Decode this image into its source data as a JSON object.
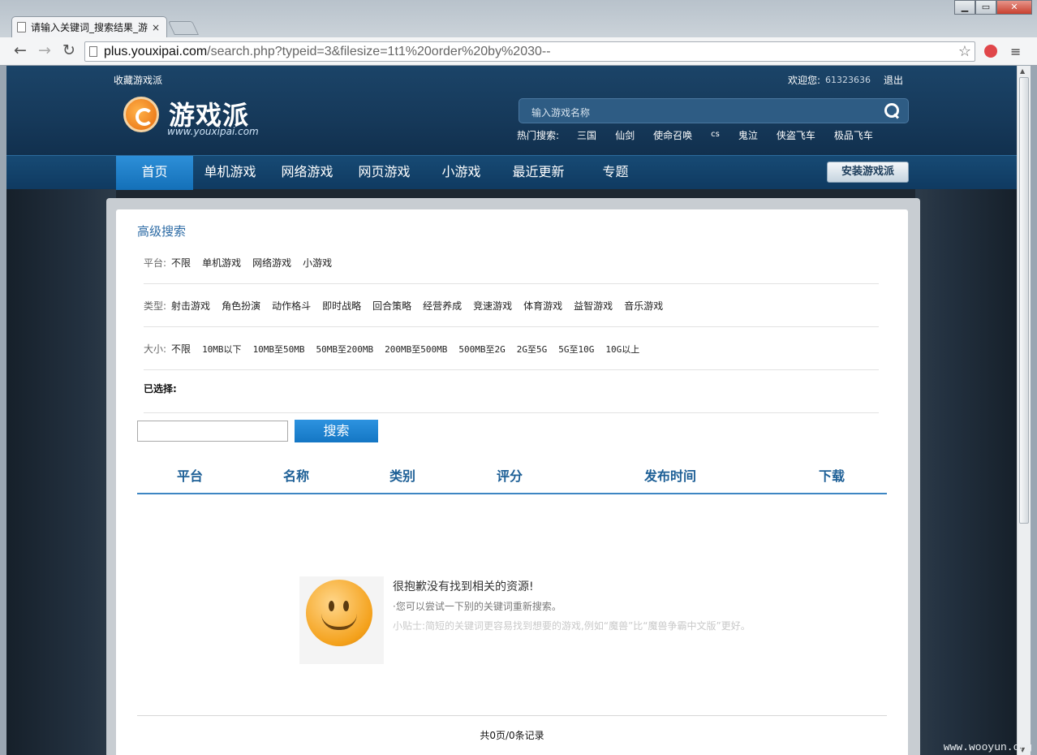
{
  "browser": {
    "tab_title": "请输入关键词_搜索结果_游",
    "tab_close": "×",
    "url_host": "plus.youxipai.com",
    "url_path": "/search.php?typeid=3&filesize=1t1%20order%20by%2030--",
    "win_min": "▁",
    "win_max": "▭",
    "win_close": "✕",
    "back": "←",
    "forward": "→",
    "reload": "↻",
    "star": "☆",
    "menu": "≡"
  },
  "header": {
    "fav_link": "收藏游戏派",
    "welcome_label": "欢迎您:",
    "user_id": "61323636",
    "logout": "退出",
    "logo_text": "游戏派",
    "logo_domain": "www.youxipai.com",
    "search_placeholder": "输入游戏名称",
    "hot_label": "热门搜索:",
    "hot_items": [
      "三国",
      "仙剑",
      "使命召唤",
      "cs",
      "鬼泣",
      "侠盗飞车",
      "极品飞车"
    ]
  },
  "nav": {
    "items": [
      "首页",
      "单机游戏",
      "网络游戏",
      "网页游戏",
      "小游戏",
      "最近更新",
      "专题"
    ],
    "install": "安装游戏派"
  },
  "search": {
    "title": "高级搜索",
    "platform_label": "平台:",
    "platform_options": [
      "不限",
      "单机游戏",
      "网络游戏",
      "小游戏"
    ],
    "type_label": "类型:",
    "type_options": [
      "射击游戏",
      "角色扮演",
      "动作格斗",
      "即时战略",
      "回合策略",
      "经营养成",
      "竞速游戏",
      "体育游戏",
      "益智游戏",
      "音乐游戏"
    ],
    "size_label": "大小:",
    "size_options": [
      "不限",
      "10MB以下",
      "10MB至50MB",
      "50MB至200MB",
      "200MB至500MB",
      "500MB至2G",
      "2G至5G",
      "5G至10G",
      "10G以上"
    ],
    "selected_label": "已选择:",
    "keyword_value": "",
    "button": "搜索"
  },
  "table": {
    "headers": [
      "平台",
      "名称",
      "类别",
      "评分",
      "发布时间",
      "下载"
    ]
  },
  "empty": {
    "title": "很抱歉没有找到相关的资源!",
    "line": "·您可以尝试一下别的关键词重新搜索。",
    "tip": "小贴士:简短的关键词更容易找到想要的游戏,例如“魔兽”比“魔兽争霸中文版”更好。"
  },
  "pager": "共0页/0条记录",
  "watermark": "www.wooyun.org"
}
